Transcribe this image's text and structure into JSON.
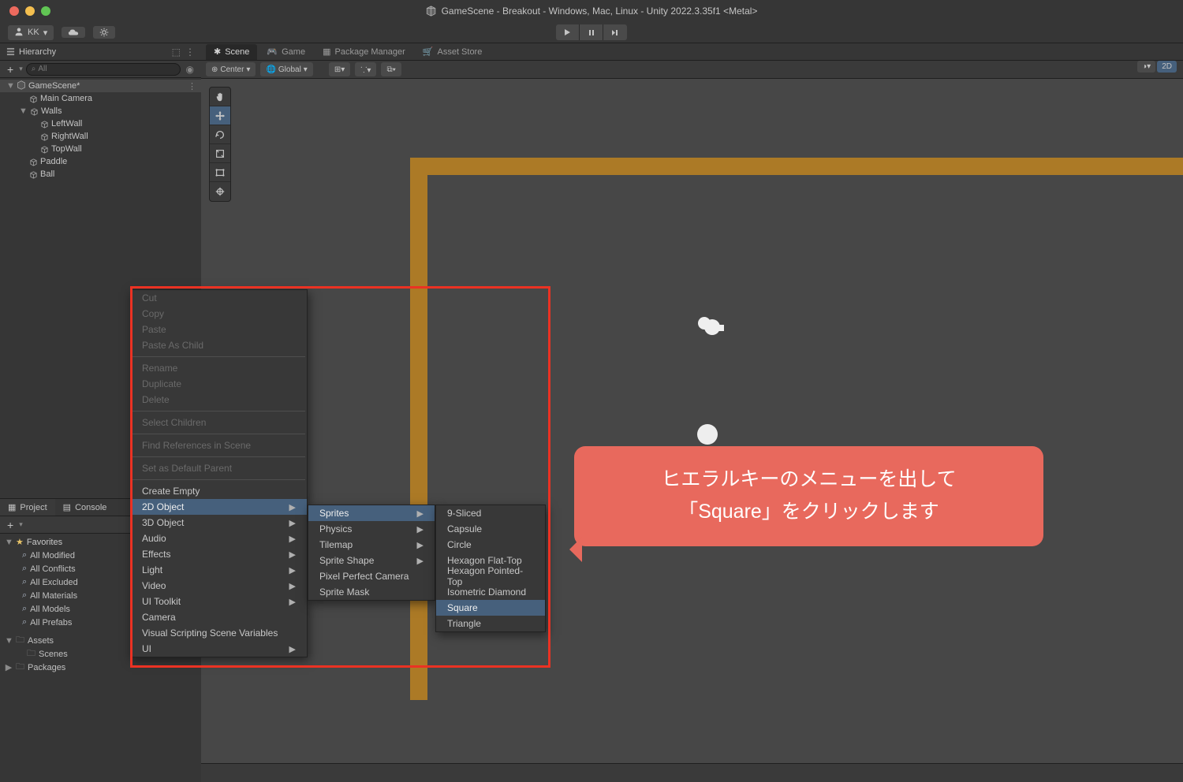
{
  "title": "GameScene - Breakout - Windows, Mac, Linux - Unity 2022.3.35f1 <Metal>",
  "user": "KK",
  "hierarchy": {
    "tab": "Hierarchy",
    "search_placeholder": "All",
    "scene": "GameScene*",
    "nodes": [
      "Main Camera",
      "Walls",
      "LeftWall",
      "RightWall",
      "TopWall",
      "Paddle",
      "Ball"
    ]
  },
  "scene_tabs": {
    "scene": "Scene",
    "game": "Game",
    "package": "Package Manager",
    "asset": "Asset Store"
  },
  "scene_tb": {
    "pivot": "Center",
    "space": "Global",
    "twoD": "2D"
  },
  "project": {
    "tabs": {
      "project": "Project",
      "console": "Console"
    },
    "fav_header": "Favorites",
    "favs": [
      "All Modified",
      "All Conflicts",
      "All Excluded",
      "All Materials",
      "All Models",
      "All Prefabs"
    ],
    "assets": "Assets",
    "scenes": "Scenes",
    "packages": "Packages"
  },
  "ctx1": {
    "group1": [
      "Cut",
      "Copy",
      "Paste",
      "Paste As Child"
    ],
    "group2": [
      "Rename",
      "Duplicate",
      "Delete"
    ],
    "group3": [
      "Select Children"
    ],
    "group4": [
      "Find References in Scene"
    ],
    "group5": [
      "Set as Default Parent"
    ],
    "group6": [
      {
        "l": "Create Empty",
        "sub": false
      },
      {
        "l": "2D Object",
        "sub": true,
        "hov": true
      },
      {
        "l": "3D Object",
        "sub": true
      },
      {
        "l": "Effects",
        "sub": true
      },
      {
        "l": "Light",
        "sub": true
      },
      {
        "l": "Audio",
        "sub": true
      },
      {
        "l": "Video",
        "sub": true
      },
      {
        "l": "UI",
        "sub": true
      },
      {
        "l": "UI Toolkit",
        "sub": true
      },
      {
        "l": "Camera",
        "sub": false
      },
      {
        "l": "Visual Scripting Scene Variables",
        "sub": false
      }
    ]
  },
  "ctx2": [
    {
      "l": "Sprites",
      "sub": true,
      "hov": true
    },
    {
      "l": "Physics",
      "sub": true
    },
    {
      "l": "Tilemap",
      "sub": true
    },
    {
      "l": "Sprite Shape",
      "sub": true
    },
    {
      "l": "Pixel Perfect Camera",
      "sub": false
    },
    {
      "l": "Sprite Mask",
      "sub": false
    }
  ],
  "ctx3": [
    "9-Sliced",
    "Capsule",
    "Circle",
    "Hexagon Flat-Top",
    "Hexagon Pointed-Top",
    "Isometric Diamond",
    "Square",
    "Triangle"
  ],
  "ctx3_hov": "Square",
  "callout_l1": "ヒエラルキーのメニューを出して",
  "callout_l2": "「Square」をクリックします"
}
